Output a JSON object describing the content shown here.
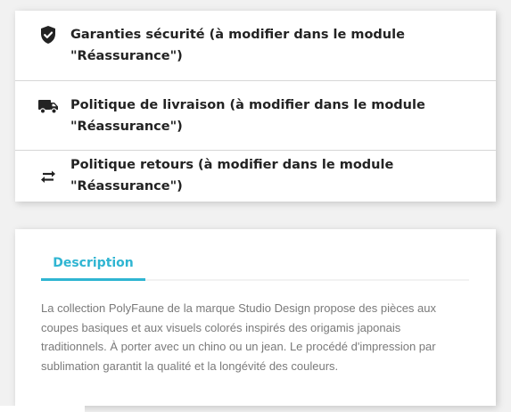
{
  "reassurance": {
    "items": [
      {
        "icon": "shield-check-icon",
        "label": "Garanties sécurité (à modifier dans le module \"Réassurance\")"
      },
      {
        "icon": "truck-icon",
        "label": "Politique de livraison (à modifier dans le module \"Réassurance\")"
      },
      {
        "icon": "swap-arrows-icon",
        "label": "Politique retours (à modifier dans le module \"Réassurance\")"
      }
    ]
  },
  "product": {
    "tabs": [
      {
        "label": "Description",
        "active": true
      }
    ],
    "description": "La collection PolyFaune de la marque Studio Design propose des pièces aux coupes basiques et aux visuels colorés inspirés des origamis japonais traditionnels. À porter avec un chino ou un jean. Le procédé d'impression par sublimation garantit la qualité et la longévité des couleurs."
  },
  "colors": {
    "accent": "#2fb5d2",
    "text": "#232323",
    "muted_text": "#7a7a7a",
    "background": "#f1f1f1",
    "card": "#ffffff"
  }
}
